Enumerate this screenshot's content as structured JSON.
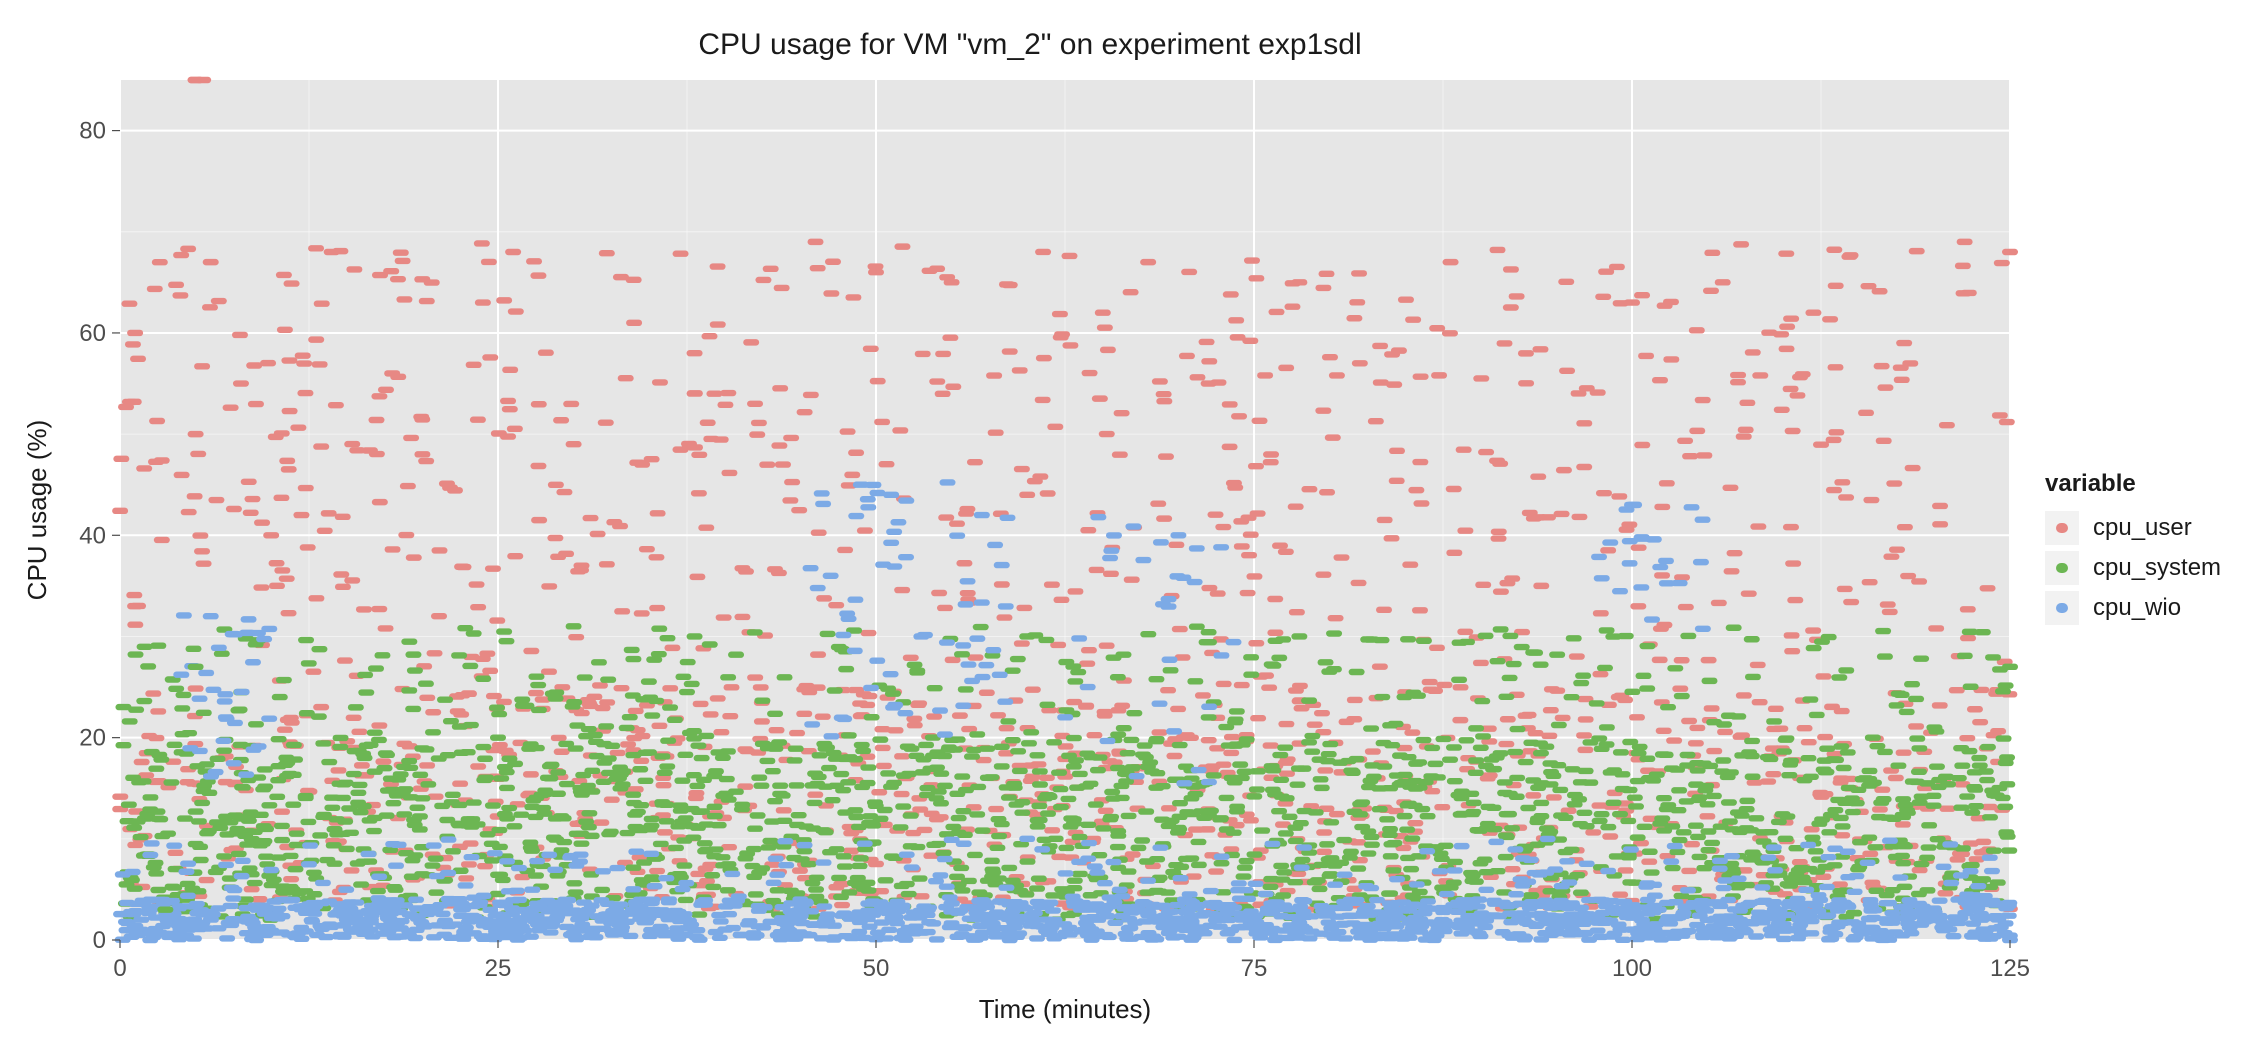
{
  "chart_data": {
    "type": "scatter",
    "title": "CPU usage for VM \"vm_2\" on experiment exp1sdl",
    "xlabel": "Time (minutes)",
    "ylabel": "CPU usage (%)",
    "xlim": [
      0,
      125
    ],
    "ylim": [
      0,
      85
    ],
    "x_ticks": [
      0,
      25,
      50,
      75,
      100,
      125
    ],
    "y_ticks": [
      0,
      20,
      40,
      60,
      80
    ],
    "grid": true,
    "legend_title": "variable",
    "legend_position": "right",
    "series": [
      {
        "name": "cpu_user",
        "color": "#e78884",
        "description": "Dense scatter of short horizontal dash markers, values mostly 5–25% with many excursions to 30–70% and one outlier near 85% at ~5 min, spread across 0–125 minutes. Representative sampled points below.",
        "sample_points": [
          {
            "x": 1,
            "y": 60
          },
          {
            "x": 1,
            "y": 33
          },
          {
            "x": 5,
            "y": 85
          },
          {
            "x": 5,
            "y": 50
          },
          {
            "x": 6,
            "y": 67
          },
          {
            "x": 8,
            "y": 55
          },
          {
            "x": 10,
            "y": 40
          },
          {
            "x": 12,
            "y": 42
          },
          {
            "x": 14,
            "y": 68
          },
          {
            "x": 18,
            "y": 56
          },
          {
            "x": 20,
            "y": 48
          },
          {
            "x": 24,
            "y": 63
          },
          {
            "x": 26,
            "y": 68
          },
          {
            "x": 30,
            "y": 49
          },
          {
            "x": 34,
            "y": 61
          },
          {
            "x": 38,
            "y": 58
          },
          {
            "x": 42,
            "y": 53
          },
          {
            "x": 46,
            "y": 69
          },
          {
            "x": 50,
            "y": 66
          },
          {
            "x": 55,
            "y": 65
          },
          {
            "x": 60,
            "y": 44
          },
          {
            "x": 65,
            "y": 62
          },
          {
            "x": 68,
            "y": 67
          },
          {
            "x": 72,
            "y": 55
          },
          {
            "x": 78,
            "y": 65
          },
          {
            "x": 82,
            "y": 57
          },
          {
            "x": 88,
            "y": 67
          },
          {
            "x": 94,
            "y": 35
          },
          {
            "x": 100,
            "y": 63
          },
          {
            "x": 106,
            "y": 65
          },
          {
            "x": 112,
            "y": 62
          },
          {
            "x": 118,
            "y": 59
          },
          {
            "x": 122,
            "y": 69
          },
          {
            "x": 125,
            "y": 68
          }
        ]
      },
      {
        "name": "cpu_system",
        "color": "#6cb653",
        "description": "Very dense band mostly between 2% and 22%, occasional spikes to ~30%, across 0–125 minutes. Representative sampled points below.",
        "sample_points": [
          {
            "x": 3,
            "y": 3
          },
          {
            "x": 5,
            "y": 27
          },
          {
            "x": 8,
            "y": 12
          },
          {
            "x": 11,
            "y": 18
          },
          {
            "x": 15,
            "y": 9
          },
          {
            "x": 20,
            "y": 14
          },
          {
            "x": 25,
            "y": 20
          },
          {
            "x": 30,
            "y": 31
          },
          {
            "x": 33,
            "y": 16
          },
          {
            "x": 38,
            "y": 30
          },
          {
            "x": 42,
            "y": 11
          },
          {
            "x": 48,
            "y": 18
          },
          {
            "x": 54,
            "y": 14
          },
          {
            "x": 60,
            "y": 30
          },
          {
            "x": 66,
            "y": 17
          },
          {
            "x": 72,
            "y": 22
          },
          {
            "x": 78,
            "y": 30
          },
          {
            "x": 84,
            "y": 15
          },
          {
            "x": 90,
            "y": 19
          },
          {
            "x": 96,
            "y": 24
          },
          {
            "x": 102,
            "y": 12
          },
          {
            "x": 108,
            "y": 26
          },
          {
            "x": 114,
            "y": 17
          },
          {
            "x": 120,
            "y": 21
          },
          {
            "x": 125,
            "y": 27
          }
        ]
      },
      {
        "name": "cpu_wio",
        "color": "#7caae6",
        "description": "Mostly a thick band near 0–4% across the full x-range, with bursts up to ~30–45% around 5, 45–60, 70, and 100 minutes. Representative sampled points below.",
        "sample_points": [
          {
            "x": 2,
            "y": 0
          },
          {
            "x": 4,
            "y": 1
          },
          {
            "x": 6,
            "y": 32
          },
          {
            "x": 7,
            "y": 22
          },
          {
            "x": 9,
            "y": 0
          },
          {
            "x": 15,
            "y": 2
          },
          {
            "x": 25,
            "y": 1
          },
          {
            "x": 35,
            "y": 3
          },
          {
            "x": 45,
            "y": 4
          },
          {
            "x": 47,
            "y": 36
          },
          {
            "x": 49,
            "y": 45
          },
          {
            "x": 51,
            "y": 44
          },
          {
            "x": 53,
            "y": 30
          },
          {
            "x": 57,
            "y": 42
          },
          {
            "x": 60,
            "y": 10
          },
          {
            "x": 64,
            "y": 25
          },
          {
            "x": 70,
            "y": 40
          },
          {
            "x": 75,
            "y": 2
          },
          {
            "x": 85,
            "y": 3
          },
          {
            "x": 95,
            "y": 1
          },
          {
            "x": 100,
            "y": 43
          },
          {
            "x": 105,
            "y": 2
          },
          {
            "x": 115,
            "y": 1
          },
          {
            "x": 125,
            "y": 0
          }
        ]
      }
    ]
  }
}
